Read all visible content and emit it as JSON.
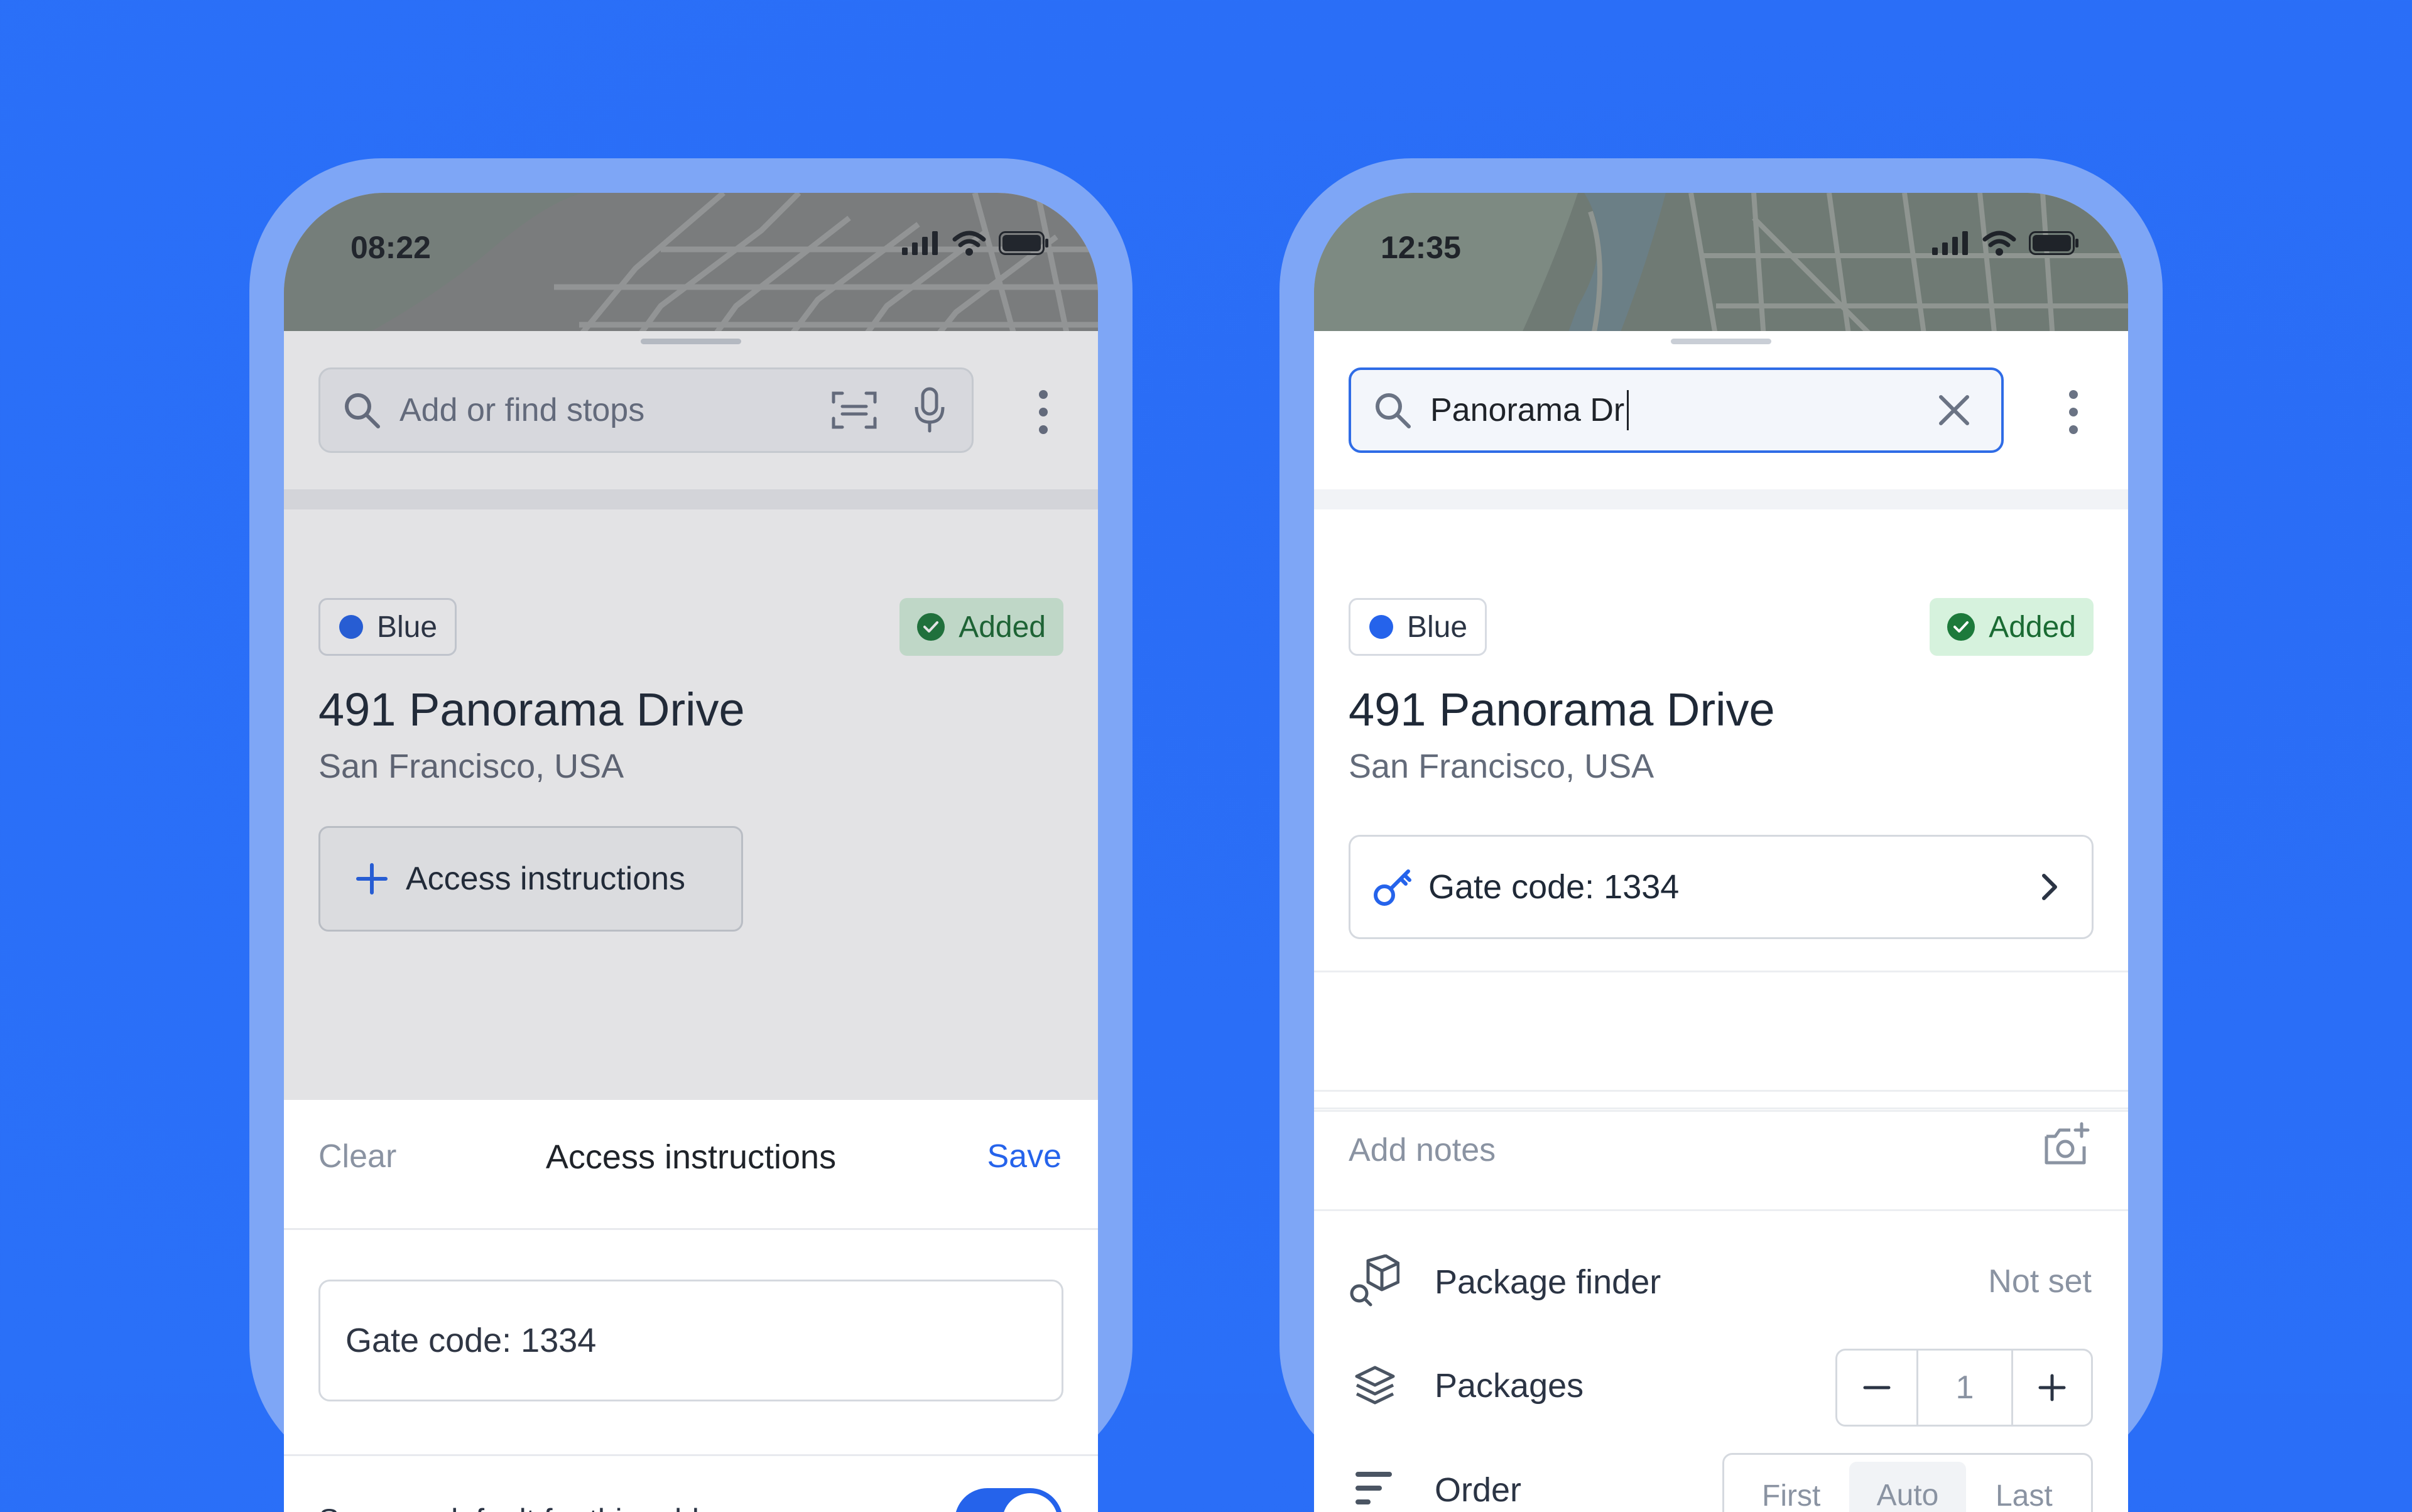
{
  "left_phone": {
    "status_time": "08:22",
    "search_placeholder": "Add or find stops",
    "tags": {
      "color_label": "Blue",
      "status_label": "Added"
    },
    "address": "491 Panorama Drive",
    "city": "San Francisco, USA",
    "access_button_label": "Access instructions",
    "modal": {
      "clear_label": "Clear",
      "title": "Access instructions",
      "save_label": "Save",
      "input_value": "Gate code: 1334",
      "default_label": "Save as default for this address",
      "default_toggle_on": true
    }
  },
  "right_phone": {
    "status_time": "12:35",
    "search_value": "Panorama Dr",
    "tags": {
      "color_label": "Blue",
      "status_label": "Added"
    },
    "address": "491 Panorama Drive",
    "city": "San Francisco, USA",
    "gate_code_label": "Gate code: 1334",
    "notes_placeholder": "Add notes",
    "package_finder": {
      "label": "Package finder",
      "value": "Not set"
    },
    "packages": {
      "label": "Packages",
      "count": "1"
    },
    "order": {
      "label": "Order",
      "options": [
        "First",
        "Auto",
        "Last"
      ],
      "selected": "Auto"
    }
  },
  "colors": {
    "background": "#2a6ef7",
    "accent": "#2563eb",
    "added_bg": "#d6f2dd",
    "added_text": "#1a6b33"
  }
}
